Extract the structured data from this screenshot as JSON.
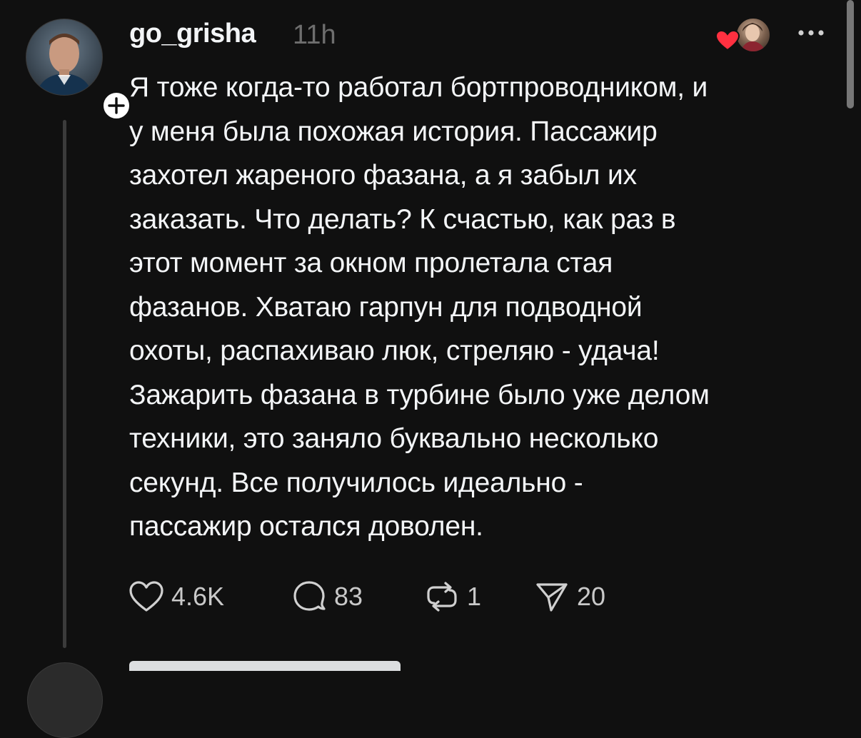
{
  "post": {
    "username": "go_grisha",
    "timestamp": "11h",
    "text": "Я тоже когда-то работал бортпроводником, и\nу меня была похожая история. Пассажир\nзахотел жареного фазана, а я забыл их\nзаказать. Что делать? К счастью, как раз в\nэтот момент за окном пролетала стая\nфазанов. Хватаю гарпун для подводной\nохоты, распахиваю люк, стреляю - удача!\nЗажарить фазана в турбине было уже делом\nтехники, это заняло буквально несколько\nсекунд. Все получилось идеально -\nпассажир остался доволен.",
    "actions": {
      "likes": "4.6K",
      "replies": "83",
      "reposts": "1",
      "shares": "20"
    },
    "icons": {
      "like": "heart-icon",
      "reply": "comment-icon",
      "repost": "repost-icon",
      "share": "send-icon",
      "more": "more-icon",
      "follow": "plus-icon",
      "liked_by": "heart-icon"
    }
  },
  "colors": {
    "background": "#101010",
    "text": "#f3f5f7",
    "muted": "#6e6e6e",
    "heart": "#ff3040",
    "thread_line": "#3b3b3b"
  }
}
